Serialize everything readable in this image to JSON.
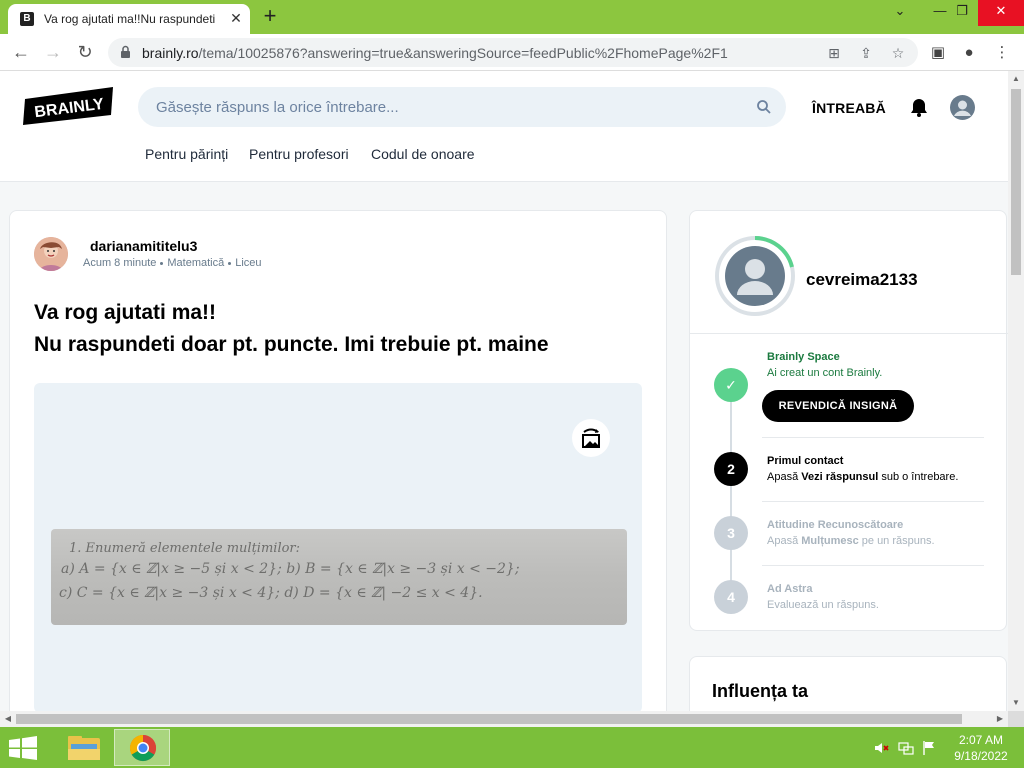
{
  "browser": {
    "tab_title": "Va rog ajutati ma!!Nu raspundeti",
    "tab_favicon": "B",
    "url_host": "brainly.ro",
    "url_path": "/tema/10025876?answering=true&answeringSource=feedPublic%2FhomePage%2F1"
  },
  "header": {
    "search_placeholder": "Găsește răspuns la orice întrebare...",
    "ask_label": "ÎNTREABĂ",
    "subnav": [
      "Pentru părinți",
      "Pentru profesori",
      "Codul de onoare"
    ]
  },
  "question": {
    "username": "darianamititelu3",
    "time": "Acum 8 minute",
    "subject": "Matematică",
    "level": "Liceu",
    "title_line1": "Va rog ajutati ma!!",
    "title_line2": "Nu raspundeti doar pt. puncte. Imi trebuie pt. maine",
    "image_lines": [
      "1. Enumeră elementele mulțimilor:",
      "a) A = {x ∈ ℤ|x ≥ −5 și x < 2}; b) B = {x ∈ ℤ|x ≥ −3 și x < −2};",
      "c) C = {x ∈ ℤ|x ≥ −3 și x < 4}; d) D = {x ∈ ℤ| −2 ≤ x < 4}."
    ]
  },
  "profile": {
    "name": "cevreima2133",
    "steps": [
      {
        "num": "✓",
        "title": "Brainly Space",
        "desc": "Ai creat un cont Brainly.",
        "button": "REVENDICĂ INSIGNĂ"
      },
      {
        "num": "2",
        "title": "Primul contact",
        "desc_pre": "Apasă ",
        "desc_bold": "Vezi răspunsul",
        "desc_post": " sub o întrebare."
      },
      {
        "num": "3",
        "title": "Atitudine Recunoscătoare",
        "desc_pre": "Apasă ",
        "desc_bold": "Mulțumesc",
        "desc_post": " pe un răspuns."
      },
      {
        "num": "4",
        "title": "Ad Astra",
        "desc": "Evaluează un răspuns."
      }
    ]
  },
  "influence": {
    "title": "Influența ta"
  },
  "taskbar": {
    "time": "2:07 AM",
    "date": "9/18/2022"
  },
  "colors": {
    "tabstrip": "#8cc63f",
    "taskbar": "#7bbf3a",
    "accent_green": "#5bd28e",
    "step_title_green": "#1b7a3f"
  }
}
